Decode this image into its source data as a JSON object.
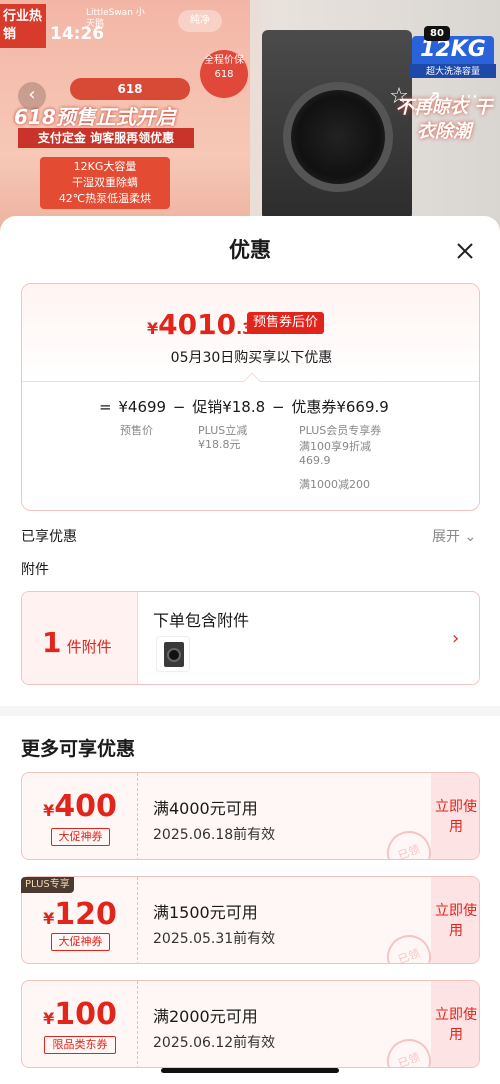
{
  "status": {
    "time": "14:26",
    "battery": "80"
  },
  "backdrop": {
    "tag": "行业热销",
    "brand": "LittleSwan 小天鹅",
    "brand2": "纯净",
    "promo_618": "618",
    "headline": "618预售正式开启",
    "sub": "支付定金 询客服再领优惠",
    "features": [
      "12KG大容量",
      "干湿双重除螨",
      "42℃热泵低温柔烘"
    ],
    "badge": "全程价保 618",
    "capacity": "12KG",
    "capacity_sub": "超大洗涤容量",
    "dry_slogan": "不再晾衣 干衣除潮"
  },
  "sheet": {
    "title": "优惠",
    "price": {
      "currency": "¥",
      "integer": "4010",
      "decimal": ".3",
      "tag": "预售券后价"
    },
    "date_line": "05月30日购买享以下优惠",
    "formula": {
      "equals": "=",
      "base": "¥4699",
      "base_label": "预售价",
      "minus1": "−",
      "promo": "促销¥18.8",
      "promo_detail": "PLUS立减 ¥18.8元",
      "minus2": "−",
      "coupon": "优惠券¥669.9",
      "coupon_detail1": "PLUS会员专享券",
      "coupon_detail2": "满100享9折减 469.9",
      "coupon_detail3": "满1000减200"
    },
    "enjoyed_label": "已享优惠",
    "expand_label": "展开",
    "attachment_label": "附件",
    "attachment": {
      "count": "1",
      "unit": "件附件",
      "title": "下单包含附件"
    },
    "more_title": "更多可享优惠",
    "coupons": [
      {
        "amount": "400",
        "kind": "大促神券",
        "condition": "满4000元可用",
        "expiry": "2025.06.18前有效",
        "action": "立即使用",
        "stamp": "已领",
        "plus": ""
      },
      {
        "amount": "120",
        "kind": "大促神券",
        "condition": "满1500元可用",
        "expiry": "2025.05.31前有效",
        "action": "立即使用",
        "stamp": "已领",
        "plus": "PLUS专享"
      },
      {
        "amount": "100",
        "kind": "限品类东券",
        "condition": "满2000元可用",
        "expiry": "2025.06.12前有效",
        "action": "立即使用",
        "stamp": "已领",
        "plus": ""
      }
    ],
    "currency": "¥"
  }
}
